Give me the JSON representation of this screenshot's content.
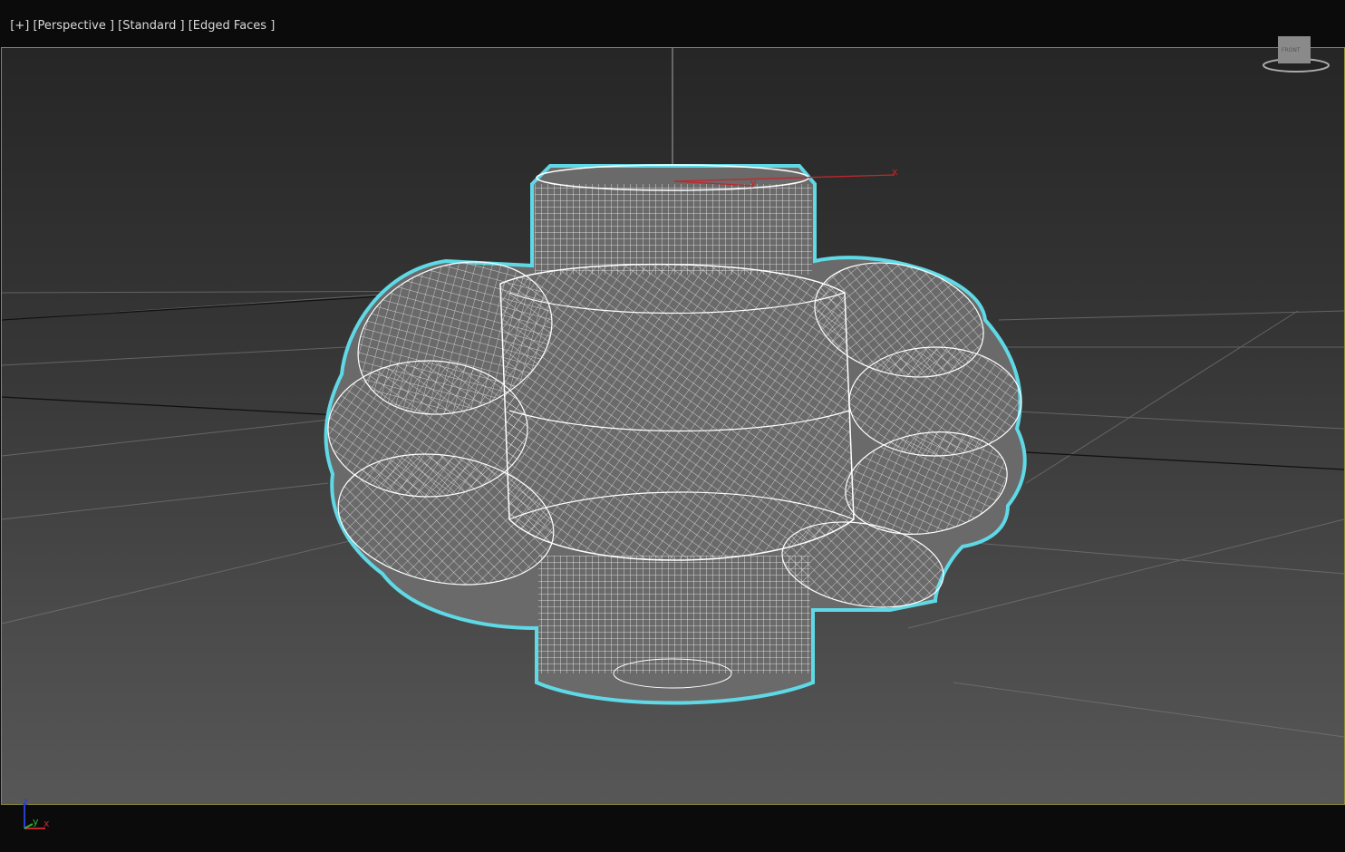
{
  "viewport_label": {
    "menu": "[+]",
    "view": "[Perspective ]",
    "shading": "[Standard ]",
    "display": "[Edged Faces ]"
  },
  "viewcube": {
    "face_label": "FRONT"
  },
  "gizmo": {
    "x_label": "x",
    "y_label": "y"
  },
  "axis_tripod": {
    "z": "z",
    "y": "y",
    "x": "x"
  },
  "colors": {
    "frame": "#8d8a3c",
    "selection": "#5fd9e6",
    "wire": "#ffffff",
    "x_axis": "#c0272d",
    "y_axis": "#2fb43a",
    "z_axis": "#2a3fcf"
  }
}
